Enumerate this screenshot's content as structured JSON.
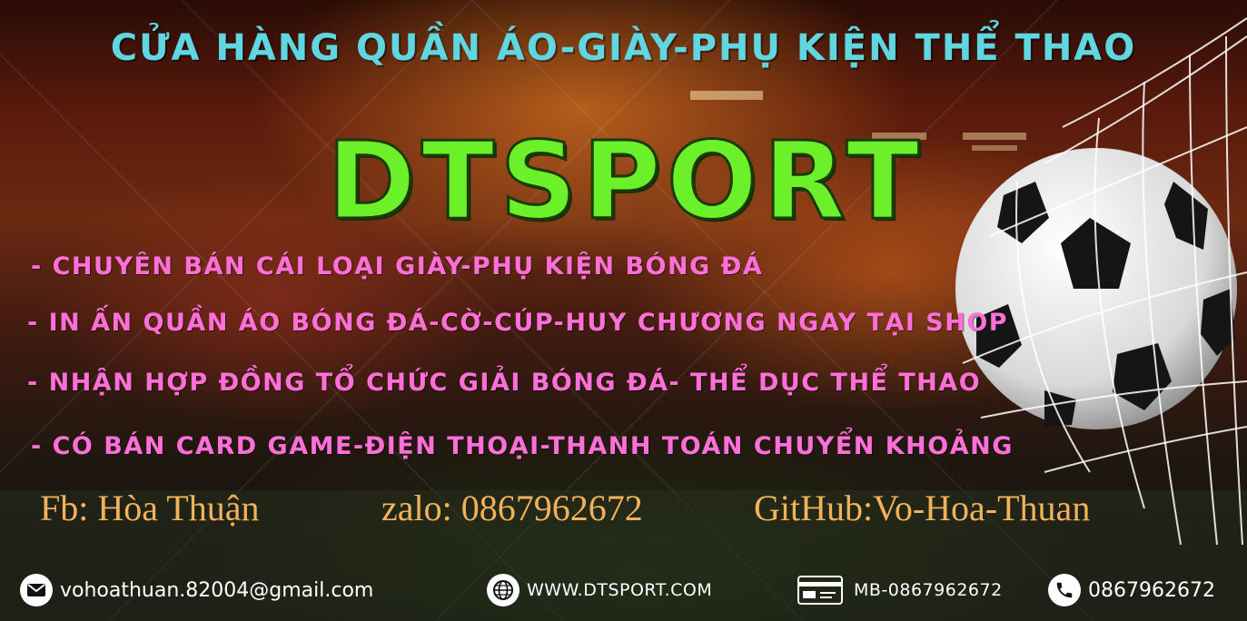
{
  "banner": {
    "title": "Cửa hàng quần áo-giày-phụ kiện thể thao",
    "brand": "DTSPORT",
    "features": [
      "- Chuyên bán cái loại giày-phụ kiện bóng đá",
      "- In ấn quần áo bóng đá-cờ-cúp-huy chương ngay tại shop",
      "- Nhận hợp đồng tổ chức giải bóng đá- thể dục thể thao",
      "- Có bán card game-điện thoại-thanh toán chuyển khoảng"
    ],
    "contacts": {
      "fb": "Fb: Hòa Thuận",
      "zalo": "zalo: 0867962672",
      "github": "GitHub:Vo-Hoa-Thuan"
    },
    "footer": {
      "email": "vohoathuan.82004@gmail.com",
      "website": "WWW.DTSPORT.COM",
      "bank": "MB-0867962672",
      "phone": "0867962672"
    },
    "icons": {
      "email": "envelope-icon",
      "website": "globe-icon",
      "bank": "bank-card-icon",
      "phone": "phone-icon",
      "ball": "soccer-ball-icon",
      "net": "goal-net-icon"
    },
    "colors": {
      "title": "#5fd6e0",
      "brand": "#6cf02a",
      "features": "#ff6fd8",
      "contacts": "#f0b25a",
      "footer_text": "#ffffff"
    }
  }
}
